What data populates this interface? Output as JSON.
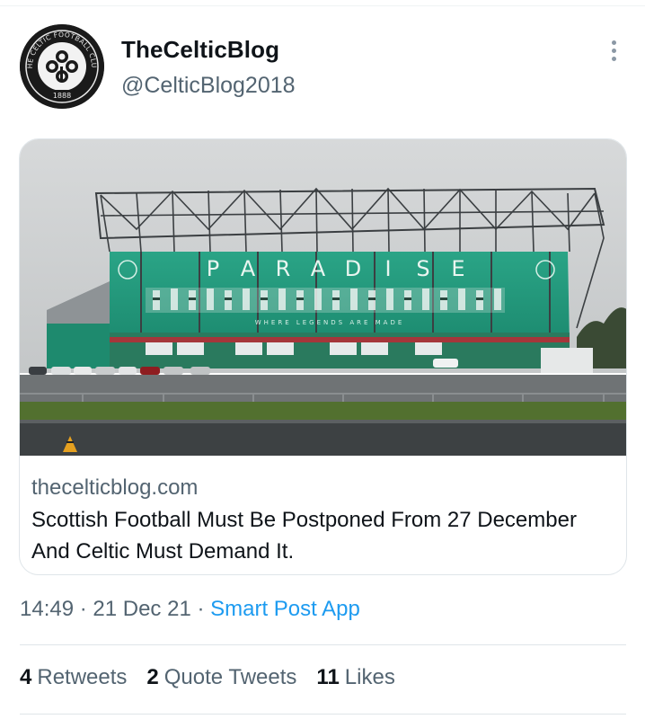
{
  "tweet": {
    "author": {
      "name": "TheCelticBlog",
      "handle": "@CelticBlog2018",
      "avatar_text": "THE CELTIC FOOTBALL CLUB",
      "avatar_year": "1888"
    },
    "card": {
      "domain": "thecelticblog.com",
      "title": "Scottish Football Must Be Postponed From 27 December And Celtic Must Demand It.",
      "image_letters": [
        "P",
        "A",
        "R",
        "A",
        "D",
        "I",
        "S",
        "E"
      ],
      "image_subtitle": "WHERE LEGENDS ARE MADE"
    },
    "meta": {
      "time": "14:49",
      "sep1": " · ",
      "date": "21 Dec 21",
      "sep2": " · ",
      "source": "Smart Post App"
    },
    "stats": {
      "retweets_count": "4",
      "retweets_label": "Retweets",
      "quotes_count": "2",
      "quotes_label": "Quote Tweets",
      "likes_count": "11",
      "likes_label": "Likes"
    }
  },
  "colors": {
    "link": "#1d9bf0",
    "secondary_text": "#536471",
    "primary_text": "#0f1419",
    "stadium_green": "#1f9d7c"
  },
  "icons": [
    "more-options-icon",
    "celtic-crest-icon"
  ]
}
